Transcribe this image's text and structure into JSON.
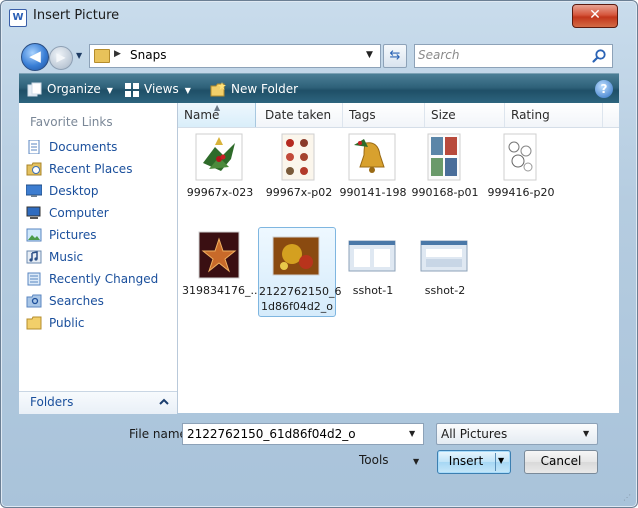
{
  "window": {
    "title": "Insert Picture",
    "close_glyph": "✕"
  },
  "nav": {
    "back_glyph": "◀",
    "forward_glyph": "▶",
    "breadcrumb_sep": "▶",
    "address_text": "Snaps",
    "refresh_glyph": "⇆"
  },
  "search": {
    "placeholder": "Search"
  },
  "toolbar": {
    "organize_label": "Organize",
    "views_label": "Views",
    "new_folder_label": "New Folder",
    "help_glyph": "?"
  },
  "sidebar": {
    "title": "Favorite Links",
    "items": [
      {
        "label": "Documents",
        "icon": "documents-icon"
      },
      {
        "label": "Recent Places",
        "icon": "recent-places-icon"
      },
      {
        "label": "Desktop",
        "icon": "desktop-icon"
      },
      {
        "label": "Computer",
        "icon": "computer-icon"
      },
      {
        "label": "Pictures",
        "icon": "pictures-icon"
      },
      {
        "label": "Music",
        "icon": "music-icon"
      },
      {
        "label": "Recently Changed",
        "icon": "recently-changed-icon"
      },
      {
        "label": "Searches",
        "icon": "searches-icon"
      },
      {
        "label": "Public",
        "icon": "public-folder-icon"
      }
    ],
    "folders_label": "Folders"
  },
  "columns": [
    "Name",
    "Date taken",
    "Tags",
    "Size",
    "Rating"
  ],
  "files": [
    {
      "caption": "99967x-023",
      "caption2": ""
    },
    {
      "caption": "99967x-p02",
      "caption2": ""
    },
    {
      "caption": "990141-198",
      "caption2": ""
    },
    {
      "caption": "990168-p01",
      "caption2": ""
    },
    {
      "caption": "999416-p20",
      "caption2": ""
    },
    {
      "caption": "319834176_...",
      "caption2": ""
    },
    {
      "caption": "2122762150_6",
      "caption2": "1d86f04d2_o"
    },
    {
      "caption": "sshot-1",
      "caption2": ""
    },
    {
      "caption": "sshot-2",
      "caption2": ""
    }
  ],
  "bottom": {
    "file_name_label": "File name:",
    "file_name_value": "2122762150_61d86f04d2_o",
    "filter_value": "All Pictures",
    "tools_label": "Tools",
    "insert_label": "Insert",
    "cancel_label": "Cancel"
  },
  "colors": {
    "toolbar": "#2e6179",
    "accent_link": "#1a4f9c",
    "selection": "#d5ebfb"
  }
}
